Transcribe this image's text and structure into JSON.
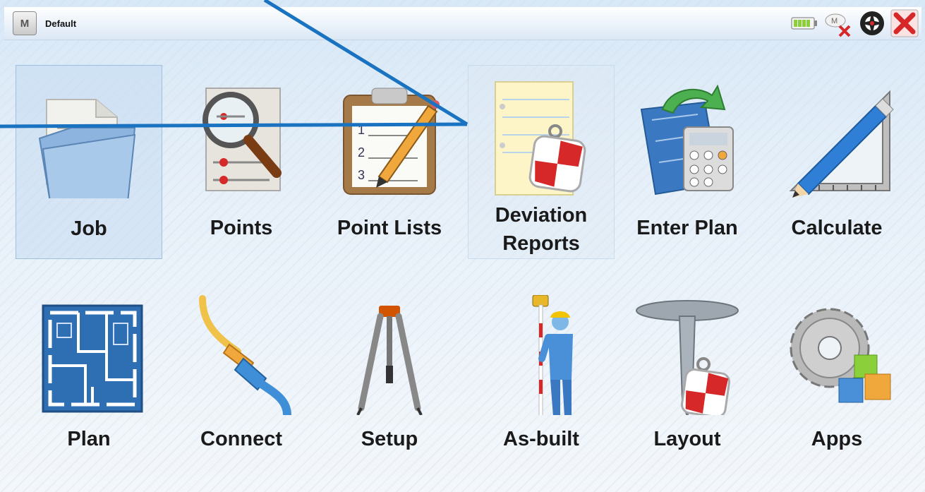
{
  "window": {
    "title": "Default",
    "menu_glyph": "M"
  },
  "status_icons": [
    "battery-icon",
    "cloud-disconnected-icon",
    "target-icon",
    "close-icon"
  ],
  "tiles_row1": [
    {
      "label": "Job"
    },
    {
      "label": "Points"
    },
    {
      "label": "Point Lists"
    },
    {
      "label_line1": "Deviation",
      "label_line2": "Reports"
    },
    {
      "label": "Enter Plan"
    },
    {
      "label": "Calculate"
    }
  ],
  "tiles_row2": [
    {
      "label": "Plan"
    },
    {
      "label": "Connect"
    },
    {
      "label": "Setup"
    },
    {
      "label": "As-built"
    },
    {
      "label": "Layout"
    },
    {
      "label": "Apps"
    }
  ],
  "point_list_numbers": [
    "1",
    "2",
    "3"
  ],
  "colors": {
    "annotation_line": "#1a73c0",
    "accent_red": "#d62828",
    "selected_border": "#9cc0de"
  }
}
